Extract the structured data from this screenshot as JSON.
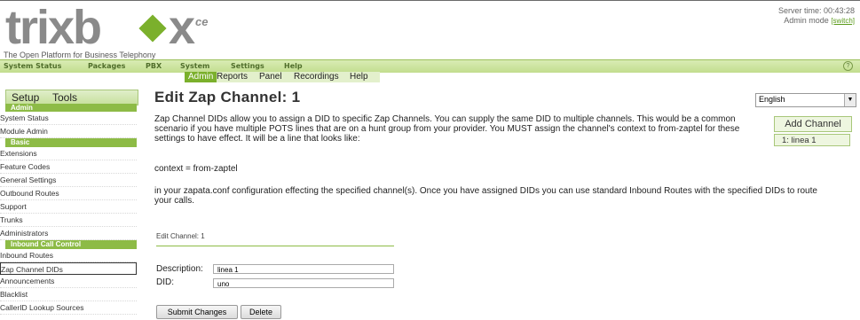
{
  "header": {
    "logo_text": "trixbox",
    "logo_suffix": "ce",
    "tagline": "The Open Platform for Business Telephony",
    "server_time": "Server time: 00:43:28",
    "mode": "Admin mode",
    "switch_label": "[switch]"
  },
  "topnav": {
    "items": [
      {
        "label": "System Status"
      },
      {
        "label": "Packages"
      },
      {
        "label": "PBX"
      },
      {
        "label": "System"
      },
      {
        "label": "Settings"
      },
      {
        "label": "Help"
      }
    ],
    "help_icon": "?"
  },
  "subnav": {
    "items": [
      {
        "label": "Admin"
      },
      {
        "label": "Reports"
      },
      {
        "label": "Panel"
      },
      {
        "label": "Recordings"
      },
      {
        "label": "Help"
      }
    ]
  },
  "sidebar": {
    "tabs": {
      "setup": "Setup",
      "tools": "Tools"
    },
    "admin_head": "Admin",
    "admin_items": [
      "System Status",
      "Module Admin"
    ],
    "basic_head": "Basic",
    "basic_items": [
      "Extensions",
      "Feature Codes",
      "General Settings",
      "Outbound Routes",
      "Support",
      "Trunks",
      "Administrators"
    ],
    "inbound_head": "Inbound Call Control",
    "inbound_items": [
      "Inbound Routes",
      "Zap Channel DIDs",
      "Announcements",
      "Blacklist",
      "CallerID Lookup Sources"
    ]
  },
  "main": {
    "title": "Edit Zap Channel: 1",
    "language": "English",
    "desc": "Zap Channel DIDs allow you to assign a DID to specific Zap Channels. You can supply the same DID to multiple channels. This would be a common scenario if you have multiple POTS lines that are on a hunt group from your provider. You MUST assign the channel's context to from-zaptel for these settings to have effect. It will be a line that looks like:",
    "context_line": "context = from-zaptel",
    "desc2": "in your zapata.conf configuration effecting the specified channel(s). Once you have assigned DIDs you can use standard Inbound Routes with the specified DIDs to route your calls.",
    "add_channel": "Add Channel",
    "channel_item": "1: linea 1",
    "edit_label": "Edit Channel: 1",
    "description_label": "Description:",
    "description_value": "linea 1",
    "did_label": "DID:",
    "did_value": "uno",
    "submit_label": "Submit Changes",
    "delete_label": "Delete"
  },
  "colors": {
    "accent": "#8dbb46",
    "logo_gray": "#8a8a8a",
    "logo_green": "#7bb02c"
  }
}
